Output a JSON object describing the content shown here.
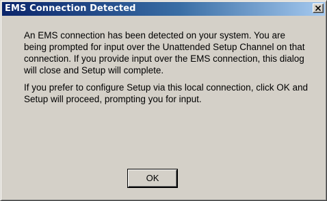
{
  "window": {
    "title": "EMS Connection Detected",
    "close_label": "close"
  },
  "message": {
    "paragraph1": "An EMS connection has been detected on your system.  You are being prompted for input over the Unattended Setup Channel on that connection.  If you provide input over the EMS connection, this dialog will close and Setup will complete.",
    "paragraph2": "If you prefer to configure Setup via this local connection, click OK and Setup will proceed, prompting you for input."
  },
  "buttons": {
    "ok_label": "OK"
  },
  "colors": {
    "title_gradient_start": "#0a246a",
    "title_gradient_end": "#a6caf0",
    "dialog_face": "#d4d0c8"
  }
}
